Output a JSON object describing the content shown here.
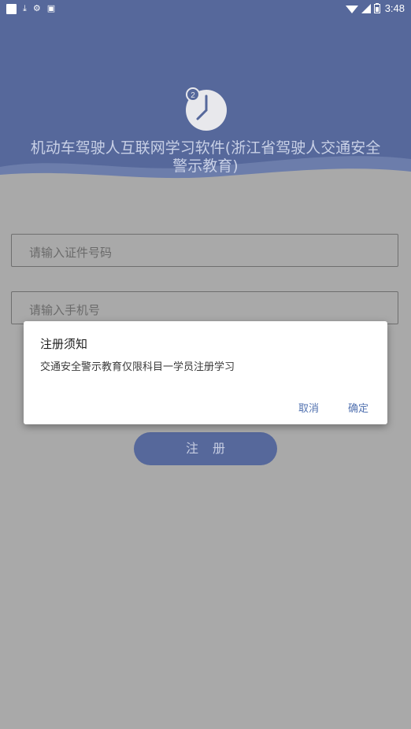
{
  "status_bar": {
    "time": "3:48",
    "left_icons": [
      "notification-square-icon",
      "download-icon",
      "settings-icon",
      "app-icon"
    ],
    "right_icons": [
      "wifi-icon",
      "signal-icon",
      "battery-icon"
    ]
  },
  "header": {
    "logo_icon": "clock-icon",
    "logo_badge": "2",
    "title_line1": "机动车驾驶人互联网学习软件(浙江省驾驶人交通安全",
    "title_line2": "警示教育)"
  },
  "form": {
    "id_placeholder": "请输入证件号码",
    "phone_placeholder": "请输入手机号",
    "register_label": "注册"
  },
  "dialog": {
    "title": "注册须知",
    "message": "交通安全警示教育仅限科目一学员注册学习",
    "cancel_label": "取消",
    "confirm_label": "确定"
  },
  "colors": {
    "header": "#56689b",
    "background": "#a9a9a9",
    "accent": "#5272b0"
  }
}
